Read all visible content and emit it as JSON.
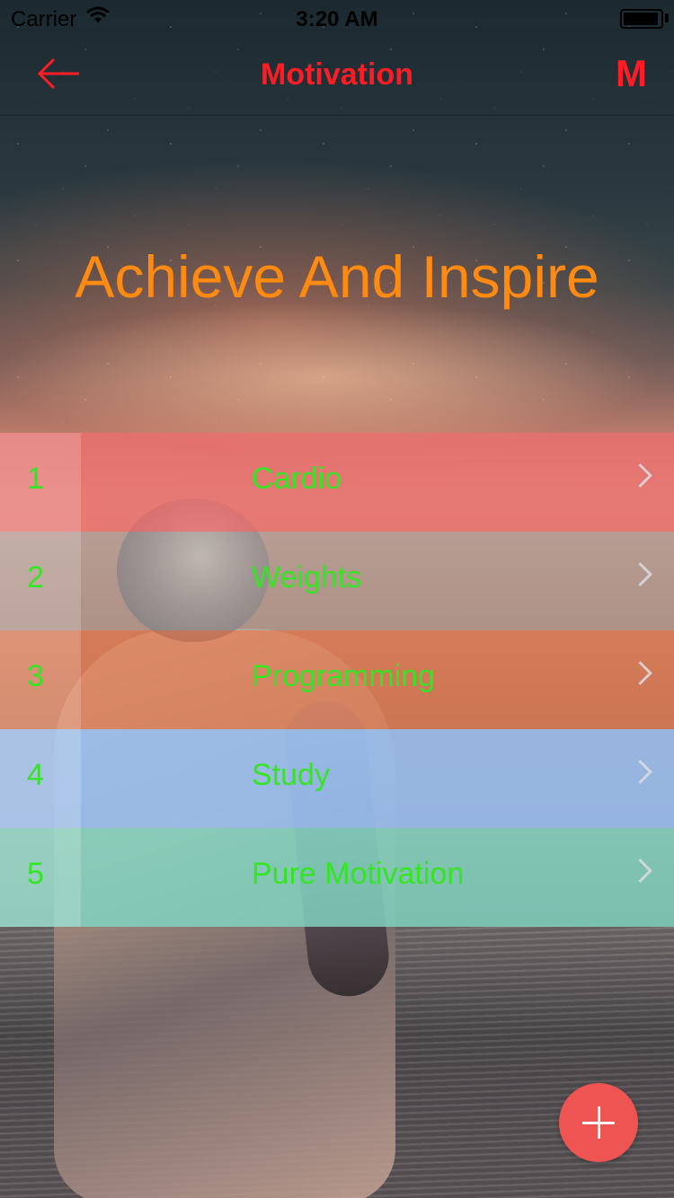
{
  "status_bar": {
    "carrier": "Carrier",
    "wifi_icon": "wifi-icon",
    "time": "3:20 AM",
    "battery_icon": "battery-icon"
  },
  "nav": {
    "back_icon": "arrow-left-icon",
    "title": "Motivation",
    "menu_label": "M",
    "accent_color": "#ff1d25"
  },
  "headline": {
    "text": "Achieve And Inspire",
    "color": "#ff8a12"
  },
  "list": {
    "text_color": "#35e524",
    "items": [
      {
        "number": "1",
        "title": "Cardio",
        "color": "rgba(236,110,110,0.78)"
      },
      {
        "number": "2",
        "title": "Weights",
        "color": "rgba(160,160,160,0.55)"
      },
      {
        "number": "3",
        "title": "Programming",
        "color": "rgba(224,120,80,0.7)"
      },
      {
        "number": "4",
        "title": "Study",
        "color": "rgba(150,190,240,0.88)"
      },
      {
        "number": "5",
        "title": "Pure Motivation",
        "color": "rgba(128,215,195,0.82)"
      }
    ]
  },
  "fab": {
    "icon": "plus-icon",
    "color": "#ee5552"
  }
}
